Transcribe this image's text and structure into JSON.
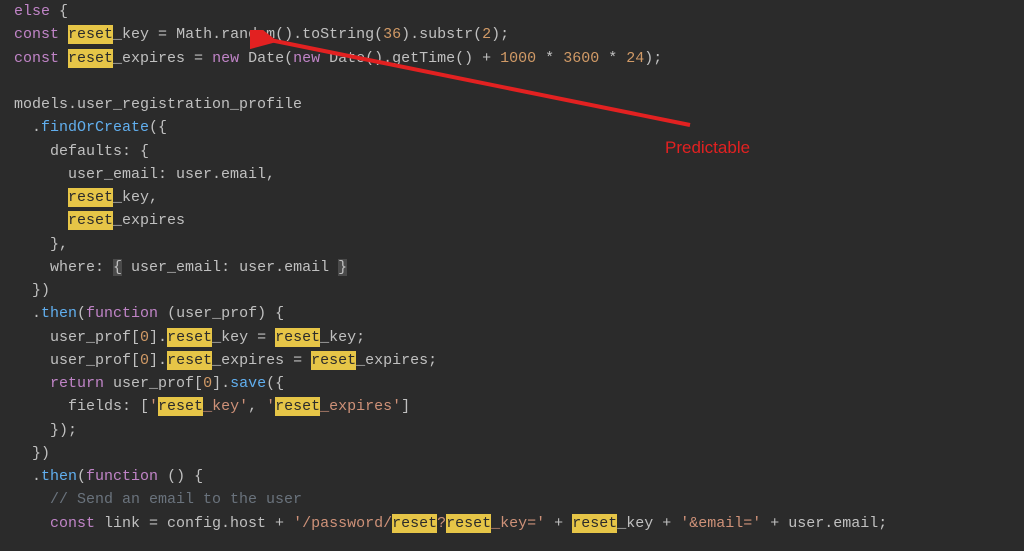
{
  "annotation": {
    "label": "Predictable"
  },
  "code": {
    "l0_kw_else": "else",
    "l0_brace": " {",
    "l1_kw_const": "const",
    "l1_sp": " ",
    "l1_hl_reset": "reset",
    "l1_key": "_key = ",
    "l1_math": "Math.random().toString(",
    "l1_num36": "36",
    "l1_after36": ").substr(",
    "l1_num2": "2",
    "l1_end": ");",
    "l2_kw_const": "const",
    "l2_sp": " ",
    "l2_hl_reset": "reset",
    "l2_exp": "_expires = ",
    "l2_kw_new1": "new",
    "l2_date1": " Date(",
    "l2_kw_new2": "new",
    "l2_date2": " Date().getTime() + ",
    "l2_n1000": "1000",
    "l2_star1": " * ",
    "l2_n3600": "3600",
    "l2_star2": " * ",
    "l2_n24": "24",
    "l2_end": ");",
    "l4": "models.user_registration_profile",
    "l5a": "  .",
    "l5b": "findOrCreate",
    "l5c": "({",
    "l6": "    defaults: {",
    "l7": "      user_email: user.email,",
    "l8a": "      ",
    "l8hl": "reset",
    "l8b": "_key,",
    "l9a": "      ",
    "l9hl": "reset",
    "l9b": "_expires",
    "l10": "    },",
    "l11a": "    where: ",
    "l11b": "{",
    "l11c": " user_email: user.email ",
    "l11d": "}",
    "l12": "  })",
    "l13a": "  .",
    "l13b": "then",
    "l13c": "(",
    "l13d": "function",
    "l13e": " (user_prof) {",
    "l14a": "    user_prof[",
    "l14n": "0",
    "l14b": "].",
    "l14hl1": "reset",
    "l14c": "_key = ",
    "l14hl2": "reset",
    "l14d": "_key;",
    "l15a": "    user_prof[",
    "l15n": "0",
    "l15b": "].",
    "l15hl1": "reset",
    "l15c": "_expires = ",
    "l15hl2": "reset",
    "l15d": "_expires;",
    "l16a": "    ",
    "l16kw": "return",
    "l16b": " user_prof[",
    "l16n": "0",
    "l16c": "].",
    "l16d": "save",
    "l16e": "({",
    "l17a": "      fields: [",
    "l17s1a": "'",
    "l17hl1": "reset",
    "l17s1b": "_key'",
    "l17comma": ", ",
    "l17s2a": "'",
    "l17hl2": "reset",
    "l17s2b": "_expires'",
    "l17end": "]",
    "l18": "    });",
    "l19": "  })",
    "l20a": "  .",
    "l20b": "then",
    "l20c": "(",
    "l20d": "function",
    "l20e": " () {",
    "l21": "    // Send an email to the user",
    "l22a": "    ",
    "l22kw": "const",
    "l22b": " link = config.host + ",
    "l22s1a": "'/password/",
    "l22hl1": "reset",
    "l22q": "?",
    "l22hl2": "reset",
    "l22s1b": "_key='",
    "l22c": " + ",
    "l22hl3": "reset",
    "l22d": "_key + ",
    "l22s2": "'&email='",
    "l22e": " + user.email;"
  }
}
